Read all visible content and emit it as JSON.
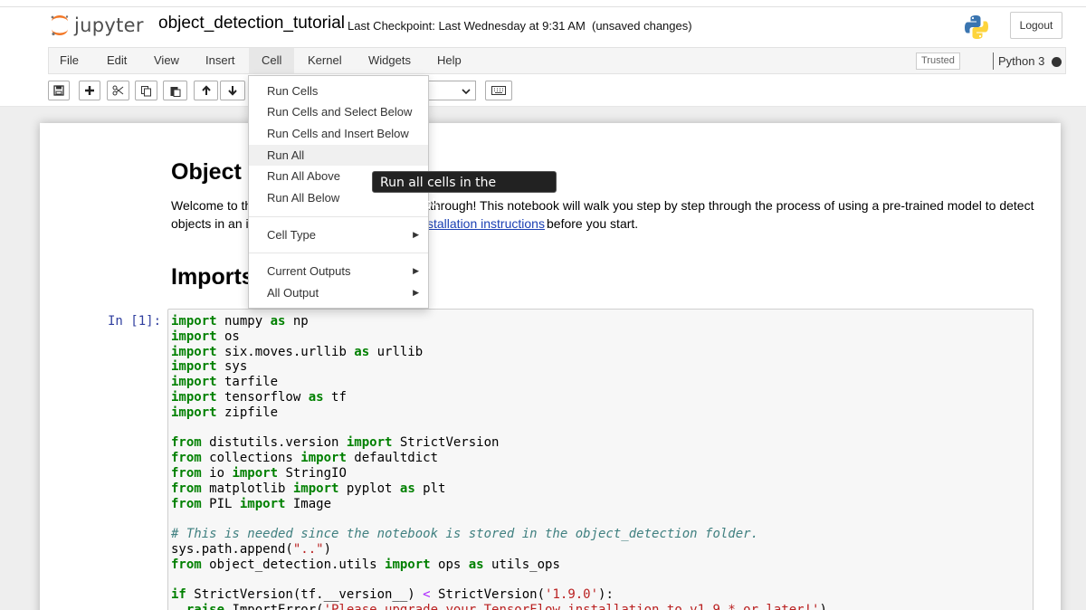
{
  "header": {
    "logo_text": "jupyter",
    "notebook_title": "object_detection_tutorial",
    "checkpoint": "Last Checkpoint: Last Wednesday at 9:31 AM",
    "unsaved": "(unsaved changes)",
    "logout_label": "Logout"
  },
  "menubar": {
    "items": [
      "File",
      "Edit",
      "View",
      "Insert",
      "Cell",
      "Kernel",
      "Widgets",
      "Help"
    ],
    "trusted": "Trusted",
    "kernel": "Python 3"
  },
  "toolbar": {
    "icons": [
      "save-icon",
      "plus-icon",
      "scissors-icon",
      "copy-icon",
      "paste-icon",
      "arrow-up-icon",
      "arrow-down-icon",
      "chevron-down-icon",
      "keyboard-icon"
    ]
  },
  "cell_menu": {
    "items": [
      "Run Cells",
      "Run Cells and Select Below",
      "Run Cells and Insert Below",
      "Run All",
      "Run All Above",
      "Run All Below"
    ],
    "cell_type": "Cell Type",
    "current_outputs": "Current Outputs",
    "all_output": "All Output",
    "hovered": "Run All"
  },
  "tooltip": "Run all cells in the notebook",
  "notebook": {
    "heading": "Object",
    "para1_left": "Welcome to th",
    "para1_right": "kthrough! This notebook will walk you step by step through the process of using a pre-trained model to detect",
    "para2_left": "objects in an i",
    "para2_link": "stallation instructions",
    "para2_right": "before you start.",
    "imports_heading": "Imports",
    "prompt": "In [1]:"
  },
  "colors": {
    "keyword": "#008000",
    "comment": "#408080",
    "string": "#ba2121",
    "prompt": "#303f9f",
    "link": "#1a3fb3"
  }
}
